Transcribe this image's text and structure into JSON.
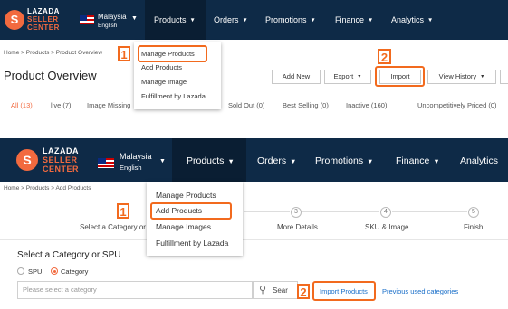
{
  "colors": {
    "nav_bg": "#0e2a47",
    "logo_orange": "#f26a3f",
    "highlight": "#f26a1e",
    "link": "#1a6fc9"
  },
  "top": {
    "logo": {
      "line1": "LAZADA",
      "line2": "SELLER",
      "line3": "CENTER"
    },
    "region": {
      "country": "Malaysia",
      "language": "English"
    },
    "nav": [
      "Products",
      "Orders",
      "Promotions",
      "Finance",
      "Analytics"
    ],
    "breadcrumb": "Home > Products > Product Overview",
    "page_title": "Product Overview",
    "buttons": {
      "add_new": "Add New",
      "export": "Export",
      "import": "Import",
      "view_history": "View History"
    },
    "filters": [
      "All (13)",
      "live (7)",
      "Image Missing",
      "Sold Out (0)",
      "Best Selling (0)",
      "Inactive (160)",
      "Uncompetitively Priced (0)"
    ],
    "menu": [
      "Manage Products",
      "Add Products",
      "Manage Image",
      "Fulfillment by Lazada"
    ],
    "badge1": "1",
    "badge2": "2"
  },
  "bottom": {
    "logo": {
      "line1": "LAZADA",
      "line2": "SELLER",
      "line3": "CENTER"
    },
    "region": {
      "country": "Malaysia",
      "language": "English"
    },
    "nav": [
      "Products",
      "Orders",
      "Promotions",
      "Finance",
      "Analytics"
    ],
    "breadcrumb": "Home > Products > Add Products",
    "steps": [
      {
        "label": "Select a Category or"
      },
      {
        "number": "3",
        "label": "More Details"
      },
      {
        "number": "4",
        "label": "SKU & Image"
      },
      {
        "number": "5",
        "label": "Finish"
      }
    ],
    "menu": [
      "Manage Products",
      "Add Products",
      "Manage Images",
      "Fulfillment by Lazada"
    ],
    "section_title": "Select a Category or SPU",
    "radios": [
      "SPU",
      "Category"
    ],
    "category_placeholder": "Please select a category",
    "search_label": "Sear",
    "import_products": "Import Products",
    "previous_categories": "Previous used categories",
    "badge1": "1",
    "badge2": "2"
  }
}
